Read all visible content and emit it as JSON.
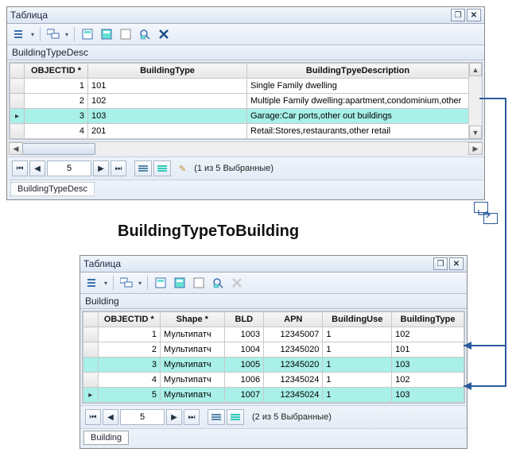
{
  "relation_title": "BuildingTypeToBuilding",
  "top": {
    "window_title": "Таблица",
    "layer_name": "BuildingTypeDesc",
    "tab_label": "BuildingTypeDesc",
    "columns": [
      "OBJECTID *",
      "BuildingType",
      "BuildingTpyeDescription"
    ],
    "rows": [
      {
        "objectid": "1",
        "btype": "101",
        "desc": "Single Family dwelling",
        "selected": false
      },
      {
        "objectid": "2",
        "btype": "102",
        "desc": "Multiple Family dwelling:apartment,condominium,other",
        "selected": false
      },
      {
        "objectid": "3",
        "btype": "103",
        "desc": "Garage:Car ports,other out buildings",
        "selected": true
      },
      {
        "objectid": "4",
        "btype": "201",
        "desc": "Retail:Stores,restaurants,other retail",
        "selected": false
      }
    ],
    "nav": {
      "pos": "5",
      "status": "(1 из 5 Выбранные)"
    }
  },
  "bottom": {
    "window_title": "Таблица",
    "layer_name": "Building",
    "tab_label": "Building",
    "columns": [
      "OBJECTID *",
      "Shape *",
      "BLD",
      "APN",
      "BuildingUse",
      "BuildingType"
    ],
    "rows": [
      {
        "objectid": "1",
        "shape": "Мультипатч",
        "bld": "1003",
        "apn": "12345007",
        "use": "1",
        "btype": "102",
        "selected": false,
        "current": false
      },
      {
        "objectid": "2",
        "shape": "Мультипатч",
        "bld": "1004",
        "apn": "12345020",
        "use": "1",
        "btype": "101",
        "selected": false,
        "current": false
      },
      {
        "objectid": "3",
        "shape": "Мультипатч",
        "bld": "1005",
        "apn": "12345020",
        "use": "1",
        "btype": "103",
        "selected": true,
        "current": false
      },
      {
        "objectid": "4",
        "shape": "Мультипатч",
        "bld": "1006",
        "apn": "12345024",
        "use": "1",
        "btype": "102",
        "selected": false,
        "current": false
      },
      {
        "objectid": "5",
        "shape": "Мультипатч",
        "bld": "1007",
        "apn": "12345024",
        "use": "1",
        "btype": "103",
        "selected": true,
        "current": true
      }
    ],
    "nav": {
      "pos": "5",
      "status": "(2 из 5 Выбранные)"
    }
  },
  "icons": {
    "restore": "❐",
    "close": "✕",
    "first": "⏮",
    "prev": "◀",
    "next": "▶",
    "last": "⏭",
    "pencil": "✎"
  }
}
